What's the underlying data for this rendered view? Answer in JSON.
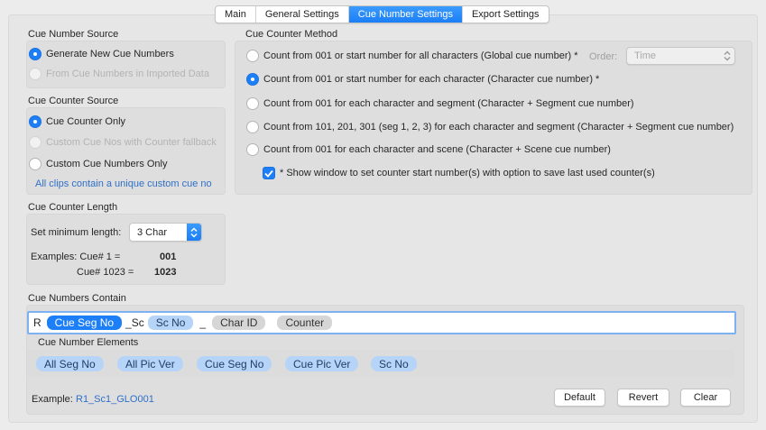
{
  "tabs": [
    {
      "label": "Main"
    },
    {
      "label": "General Settings"
    },
    {
      "label": "Cue Number Settings"
    },
    {
      "label": "Export Settings"
    }
  ],
  "cue_number_source": {
    "title": "Cue Number Source",
    "options": [
      {
        "label": "Generate New Cue Numbers",
        "selected": true,
        "disabled": false
      },
      {
        "label": "From Cue Numbers in Imported Data",
        "selected": false,
        "disabled": true
      }
    ]
  },
  "cue_counter_source": {
    "title": "Cue Counter Source",
    "options": [
      {
        "label": "Cue Counter Only",
        "selected": true,
        "disabled": false
      },
      {
        "label": "Custom Cue Nos with Counter fallback",
        "selected": false,
        "disabled": true
      },
      {
        "label": "Custom Cue Numbers Only",
        "selected": false,
        "disabled": false
      }
    ],
    "note": "All clips contain a unique custom cue no"
  },
  "cue_counter_length": {
    "title": "Cue Counter Length",
    "min_length_label": "Set minimum length:",
    "min_length_value": "3 Char",
    "examples_label": "Examples: Cue# 1 =",
    "example1_value": "001",
    "example2_label": "Cue# 1023 =",
    "example2_value": "1023"
  },
  "cue_counter_method": {
    "title": "Cue Counter Method",
    "order_label": "Order:",
    "order_value": "Time",
    "options": [
      {
        "label": "Count from 001 or start number for all characters (Global cue number) *",
        "selected": false
      },
      {
        "label": "Count from 001 or start number for each character (Character cue number) *",
        "selected": true
      },
      {
        "label": "Count from 001 for each character and segment (Character + Segment cue number)",
        "selected": false
      },
      {
        "label": "Count from 101, 201, 301 (seg 1, 2, 3) for each character and segment (Character + Segment cue number)",
        "selected": false
      },
      {
        "label": "Count from 001 for each character and scene (Character + Scene cue number)",
        "selected": false
      }
    ],
    "show_window_label": "* Show window to set counter start number(s) with option to save last used counter(s)",
    "show_window_checked": true
  },
  "cue_numbers_contain": {
    "title": "Cue Numbers Contain",
    "prefix": "R",
    "tokens": [
      "Cue Seg No",
      "_Sc",
      "Sc No",
      "_",
      "Char ID",
      "Counter"
    ]
  },
  "cue_number_elements": {
    "title": "Cue Number Elements",
    "items": [
      "All Seg No",
      "All Pic Ver",
      "Cue Seg No",
      "Cue Pic Ver",
      "Sc No"
    ]
  },
  "example": {
    "label": "Example:",
    "value": "R1_Sc1_GLO001"
  },
  "buttons": {
    "default": "Default",
    "revert": "Revert",
    "clear": "Clear"
  },
  "colors": {
    "accent": "#1c7ff7",
    "token_blue": "#b6d4f7",
    "token_grey": "#d6d6d6",
    "link": "#2f6fc9"
  }
}
